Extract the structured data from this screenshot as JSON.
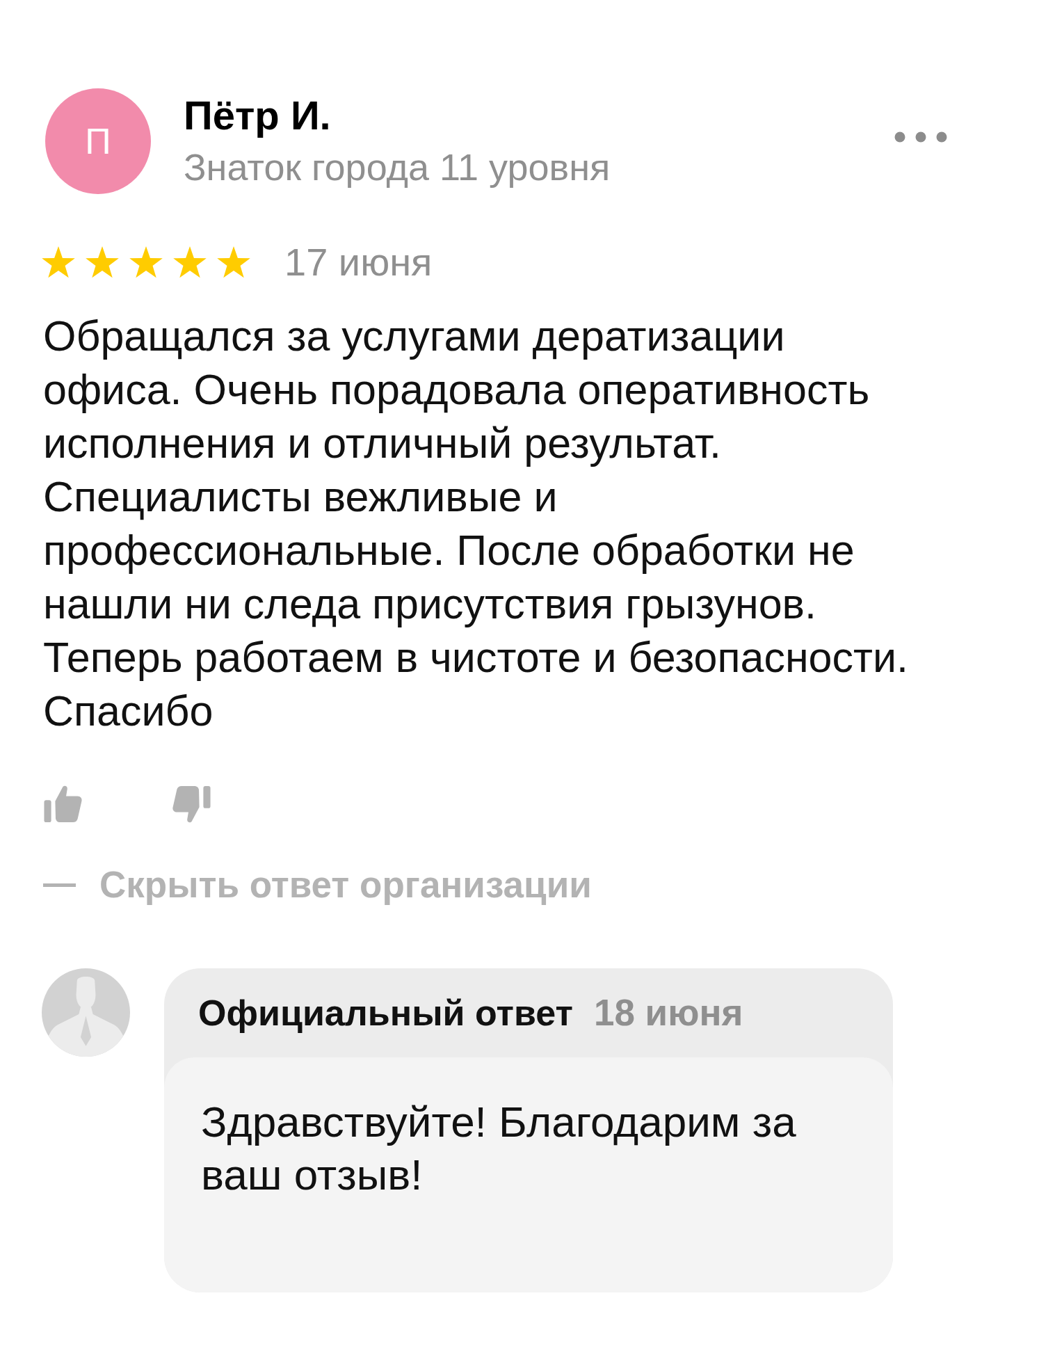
{
  "review": {
    "author": {
      "initial": "П",
      "name": "Пётр И.",
      "status": "Знаток города 11 уровня"
    },
    "stars": 5,
    "date": "17 июня",
    "text": "Обращался за услугами дератизации офиса. Очень порадовала оперативность исполнения и отличный результат. Специалисты вежливые и профессиональные. После обработки не нашли ни следа присутствия грызунов. Теперь работаем в чистоте и безопасности. Спасибо"
  },
  "response_toggle": {
    "label": "Скрыть ответ организации",
    "expanded": true
  },
  "official_response": {
    "title": "Официальный ответ",
    "date": "18 июня",
    "text": "Здравствуйте! Благодарим за ваш отзыв!"
  }
}
